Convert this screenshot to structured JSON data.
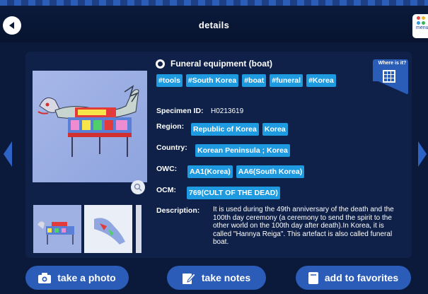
{
  "header": {
    "title": "details",
    "menu_label": "menu"
  },
  "item": {
    "name": "Funeral equipment (boat)",
    "tags": [
      "#tools",
      "#South Korea",
      "#boat",
      "#funeral",
      "#Korea"
    ],
    "where_label": "Where is it?",
    "specimen_label": "Specimen ID:",
    "specimen_id": "H0213619",
    "region_label": "Region:",
    "region": [
      "Republic of Korea",
      "Korea"
    ],
    "country_label": "Country:",
    "country": [
      "Korean Peninsula ; Korea"
    ],
    "owc_label": "OWC:",
    "owc": [
      "AA1(Korea)",
      "AA6(South Korea)"
    ],
    "ocm_label": "OCM:",
    "ocm": [
      "769(CULT OF THE DEAD)"
    ],
    "description_label": "Description:",
    "description": "It is used during the 49th anniversary of the death and the 100th day ceremony (a ceremony to send the spirit to the other world on the 100th day after death).In Korea, it is called \"Hannya Reiga\". This artefact is also called funeral boat."
  },
  "actions": {
    "photo": "take a photo",
    "notes": "take notes",
    "favorites": "add to favorites"
  },
  "colors": {
    "background": "#0b1a3a",
    "panel": "#0f2148",
    "chip": "#1e9ae0",
    "button": "#2a5cb8"
  },
  "icons": [
    "back-arrow-icon",
    "menu-grid-icon",
    "map-grid-icon",
    "zoom-icon",
    "camera-icon",
    "pencil-note-icon",
    "bookmark-icon",
    "chevron-left-icon",
    "chevron-right-icon"
  ]
}
